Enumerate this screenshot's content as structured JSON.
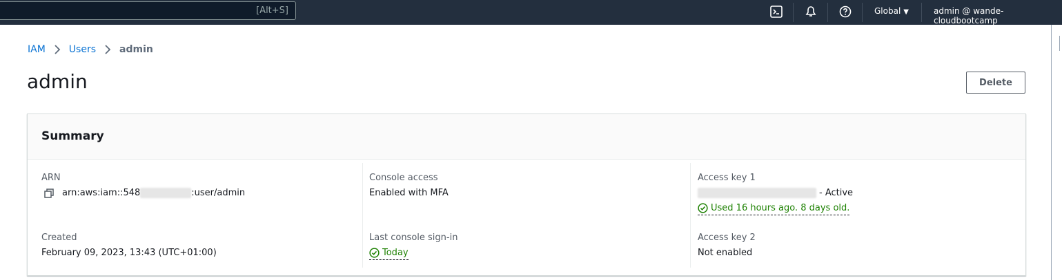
{
  "topbar": {
    "search_hint": "[Alt+S]",
    "region": "Global",
    "account": "admin @ wande-cloudbootcamp",
    "icons": [
      "cloudshell-icon",
      "bell-icon",
      "help-icon"
    ]
  },
  "breadcrumb": {
    "items": [
      "IAM",
      "Users"
    ],
    "current": "admin"
  },
  "page": {
    "title": "admin",
    "delete_label": "Delete"
  },
  "summary": {
    "title": "Summary",
    "arn": {
      "label": "ARN",
      "prefix": "arn:aws:iam::548",
      "suffix": ":user/admin"
    },
    "created": {
      "label": "Created",
      "value": "February 09, 2023, 13:43 (UTC+01:00)"
    },
    "console_access": {
      "label": "Console access",
      "value": "Enabled with MFA"
    },
    "last_signin": {
      "label": "Last console sign-in",
      "value": "Today"
    },
    "access_key_1": {
      "label": "Access key 1",
      "status": "- Active",
      "usage": "Used 16 hours ago. 8 days old."
    },
    "access_key_2": {
      "label": "Access key 2",
      "value": "Not enabled"
    }
  },
  "colors": {
    "link": "#0972d3",
    "success": "#1d8102",
    "topbar": "#232f3e"
  }
}
